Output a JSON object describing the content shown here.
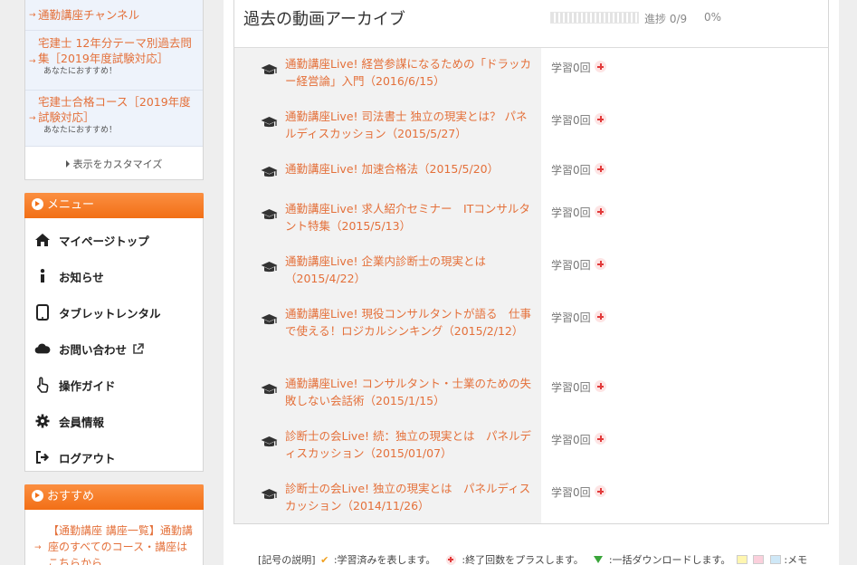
{
  "sidebar": {
    "courses": [
      {
        "title": "通勤講座チャンネル",
        "sub": ""
      },
      {
        "title": "宅建士 12年分テーマ別過去問集［2019年度試験対応］",
        "sub": "あなたにおすすめ！"
      },
      {
        "title": "宅建士合格コース［2019年度試験対応］",
        "sub": "あなたにおすすめ！"
      }
    ],
    "customize_label": "表示をカスタマイズ",
    "menu_title": "メニュー",
    "menu_items": [
      {
        "label": "マイページトップ",
        "icon": "home-icon"
      },
      {
        "label": "お知らせ",
        "icon": "info-icon"
      },
      {
        "label": "タブレットレンタル",
        "icon": "tablet-icon"
      },
      {
        "label": "お問い合わせ",
        "icon": "cloud-icon"
      },
      {
        "label": "操作ガイド",
        "icon": "pointer-hand-icon"
      },
      {
        "label": "会員情報",
        "icon": "gear-icon"
      },
      {
        "label": "ログアウト",
        "icon": "logout-icon"
      }
    ],
    "recommend_title": "おすすめ",
    "recommend_text": "【通勤講座 講座一覧】通勤講座のすべてのコース・講座はこちらから"
  },
  "archive": {
    "title": "過去の動画アーカイブ",
    "progress_label": "進捗 0/9",
    "progress_percent": "0%",
    "progress_value": 0,
    "videos": [
      {
        "title": "通勤講座Live! 経営参謀になるための「ドラッカー経営論」入門（2016/6/15）",
        "study": "学習0回"
      },
      {
        "title": "通勤講座Live! 司法書士 独立の現実とは？ パネルディスカッション（2015/5/27）",
        "study": "学習0回"
      },
      {
        "title": "通勤講座Live! 加速合格法（2015/5/20）",
        "study": "学習0回"
      },
      {
        "title": "通勤講座Live! 求人紹介セミナー　ITコンサルタント特集（2015/5/13）",
        "study": "学習0回"
      },
      {
        "title": "通勤講座Live! 企業内診断士の現実とは（2015/4/22）",
        "study": "学習0回"
      },
      {
        "title": "通勤講座Live! 現役コンサルタントが語る　仕事で使える！ロジカルシンキング（2015/2/12）",
        "study": "学習0回"
      },
      {
        "title": "通勤講座Live! コンサルタント・士業のための失敗しない会話術（2015/1/15）",
        "study": "学習0回"
      },
      {
        "title": "診断士の会Live! 続：独立の現実とは　パネルディスカッション（2015/01/07）",
        "study": "学習0回"
      },
      {
        "title": "診断士の会Live! 独立の現実とは　パネルディスカッション（2014/11/26）",
        "study": "学習0回"
      }
    ]
  },
  "legend": {
    "prefix": "[記号の説明]",
    "done": ":学習済みを表します。",
    "plus": ":終了回数をプラスします。",
    "download": ":一括ダウンロードします。",
    "memo": ":メモ"
  },
  "colors": {
    "accent": "#f26f16",
    "link": "#e4703a",
    "plus": "#e23a3a"
  }
}
